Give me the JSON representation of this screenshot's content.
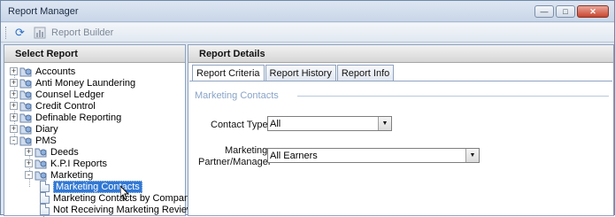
{
  "window": {
    "title": "Report Manager",
    "controls": [
      "minimize",
      "maximize",
      "close"
    ]
  },
  "toolbar": {
    "refresh_icon": "refresh-icon",
    "report_builder_label": "Report Builder"
  },
  "left_panel": {
    "header": "Select Report",
    "tree": [
      {
        "label": "Accounts",
        "level": 0,
        "expander": "+"
      },
      {
        "label": "Anti Money Laundering",
        "level": 0,
        "expander": "+"
      },
      {
        "label": "Counsel Ledger",
        "level": 0,
        "expander": "+"
      },
      {
        "label": "Credit Control",
        "level": 0,
        "expander": "+"
      },
      {
        "label": "Definable Reporting",
        "level": 0,
        "expander": "+"
      },
      {
        "label": "Diary",
        "level": 0,
        "expander": "+"
      },
      {
        "label": "PMS",
        "level": 0,
        "expander": "-"
      },
      {
        "label": "Deeds",
        "level": 1,
        "expander": "+"
      },
      {
        "label": "K.P.I Reports",
        "level": 1,
        "expander": "+"
      },
      {
        "label": "Marketing",
        "level": 1,
        "expander": "-"
      },
      {
        "label": "Marketing Contacts",
        "level": 2,
        "selected": true
      },
      {
        "label": "Marketing Contacts by Company",
        "level": 2
      },
      {
        "label": "Not Receiving Marketing Review",
        "level": 2
      }
    ]
  },
  "right_panel": {
    "header": "Report Details",
    "tabs": [
      "Report Criteria",
      "Report History",
      "Report Info"
    ],
    "active_tab": "Report Criteria",
    "section_title": "Marketing Contacts",
    "fields": {
      "contact_type_label": "Contact Type",
      "contact_type_value": "All",
      "partner_label_line1": "Marketing",
      "partner_label_line2": "Partner/Manager",
      "partner_value": "All Earners"
    }
  }
}
